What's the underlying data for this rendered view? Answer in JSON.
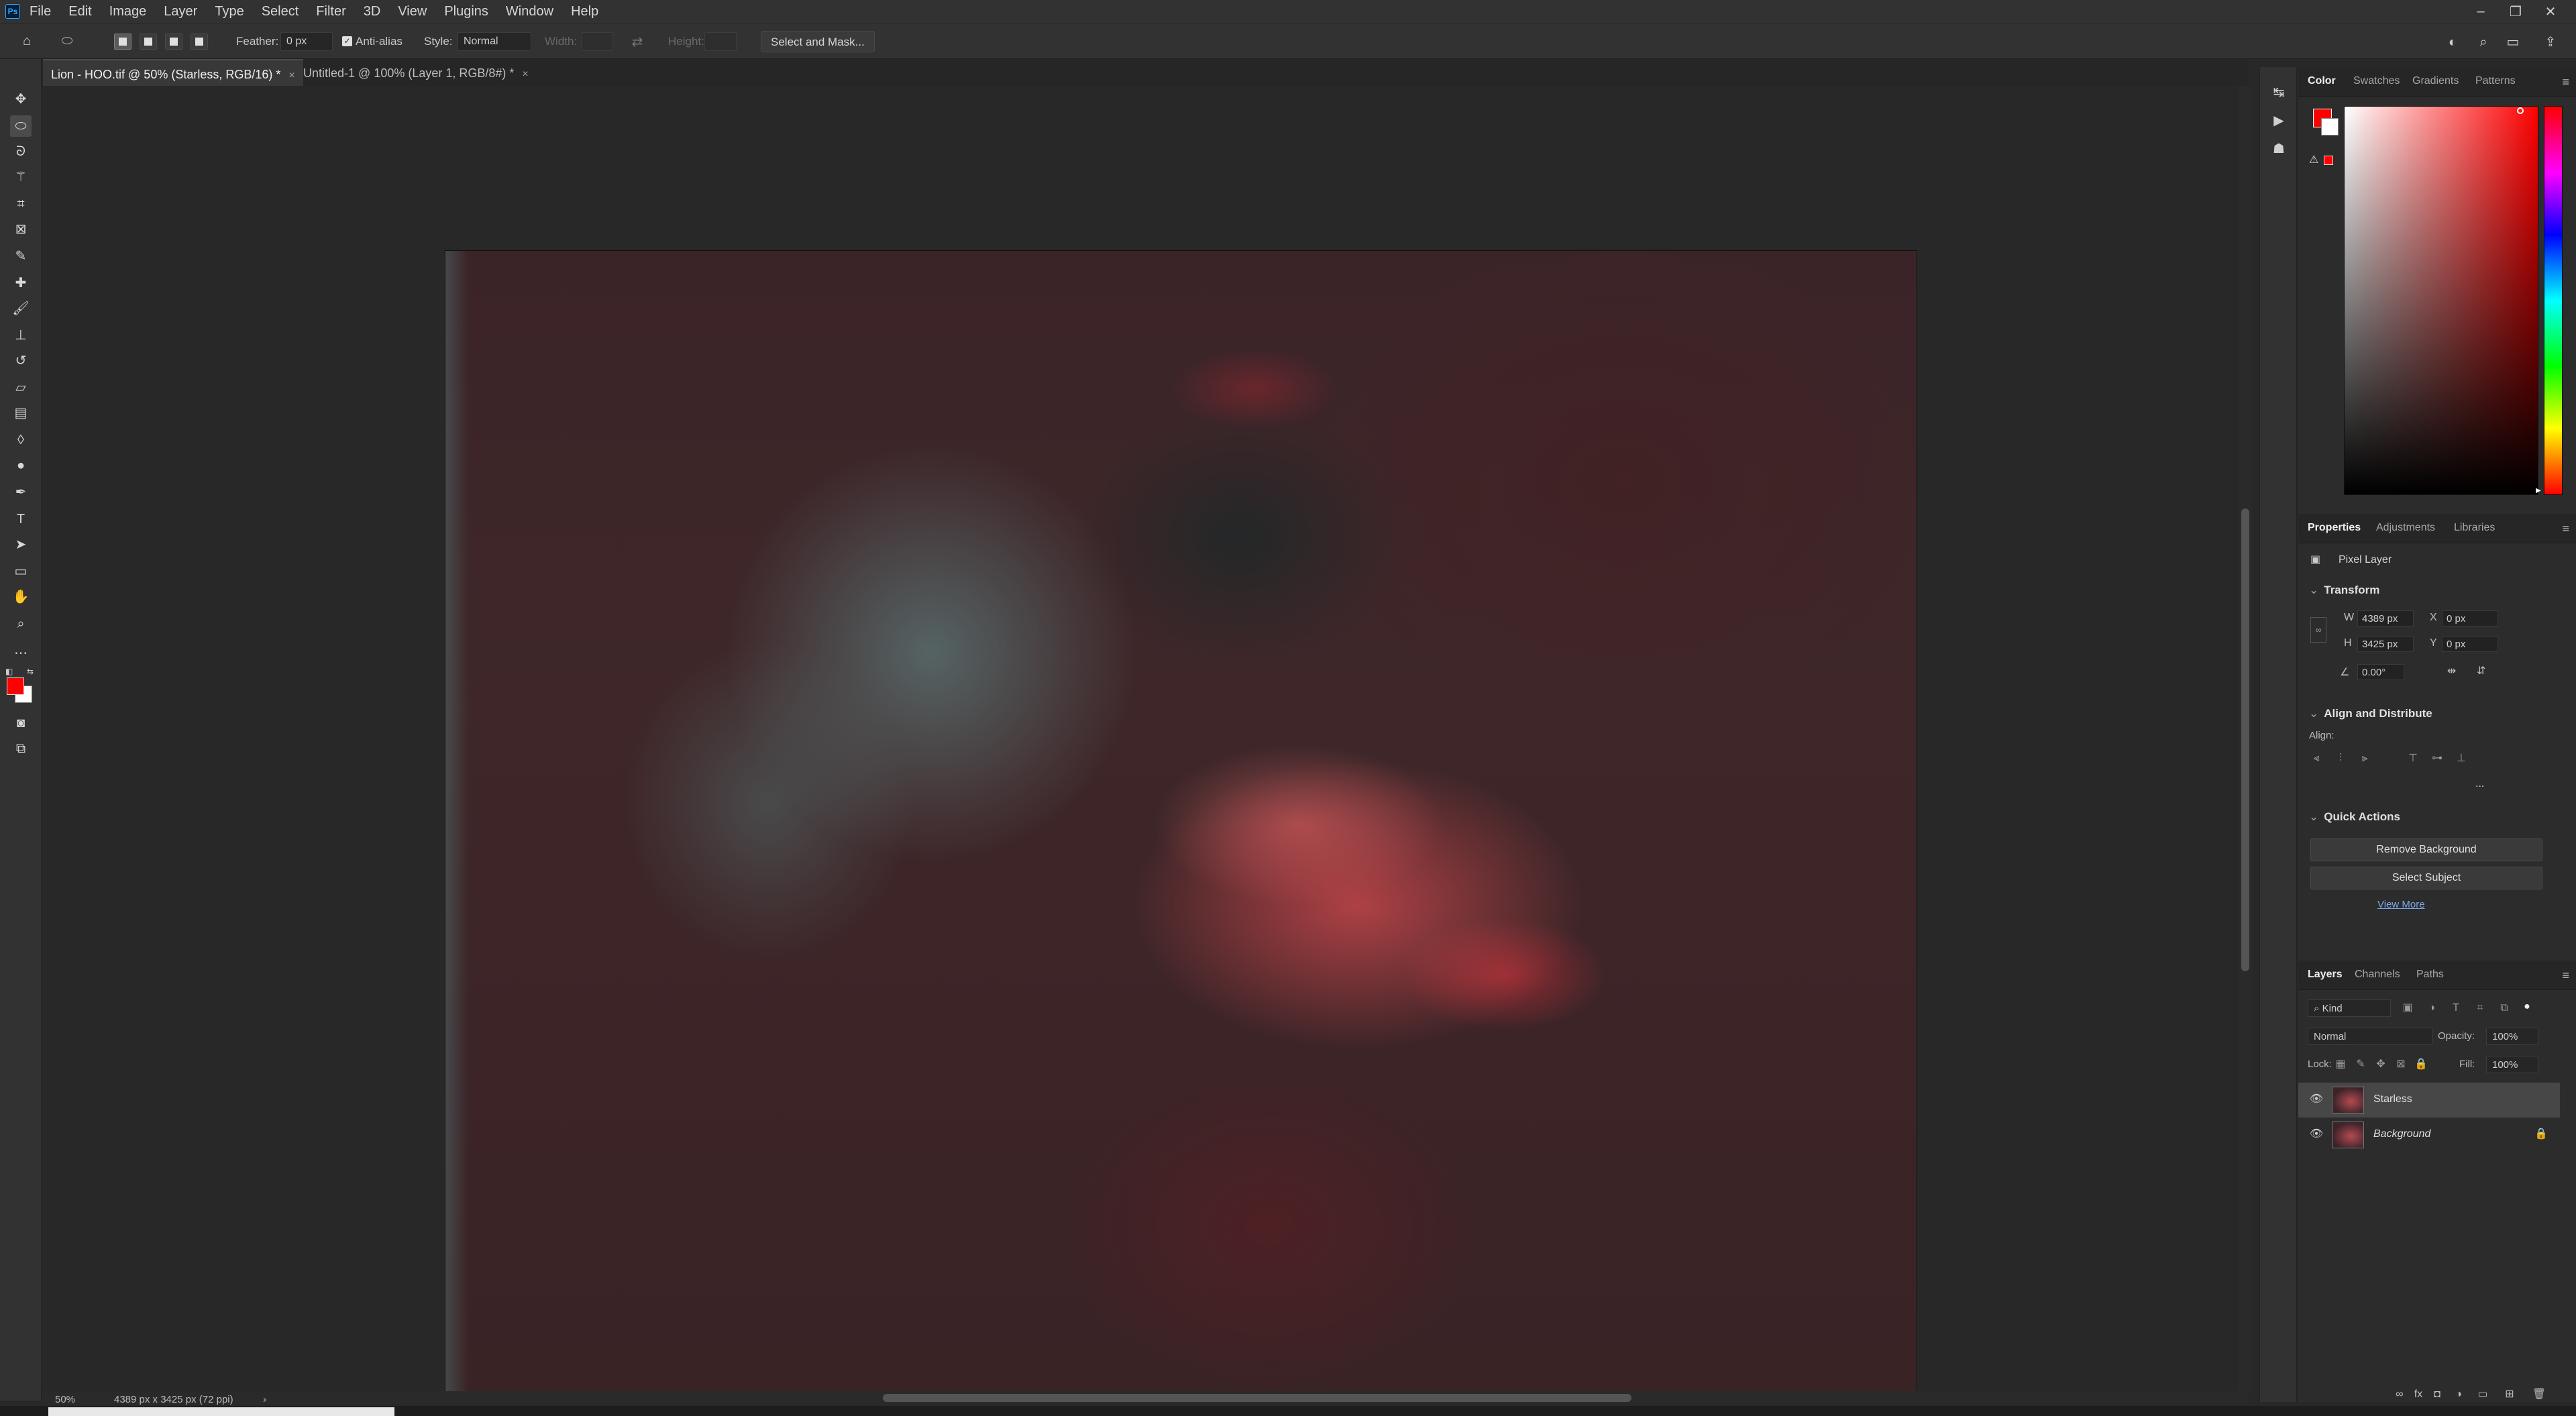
{
  "menu": [
    "File",
    "Edit",
    "Image",
    "Layer",
    "Type",
    "Select",
    "Filter",
    "3D",
    "View",
    "Plugins",
    "Window",
    "Help"
  ],
  "app_icon": "Ps",
  "window_controls": {
    "minimize": "–",
    "restore": "❐",
    "close": "✕"
  },
  "options": {
    "feather_label": "Feather:",
    "feather_value": "0 px",
    "antialias_label": "Anti-alias",
    "style_label": "Style:",
    "style_value": "Normal",
    "width_label": "Width:",
    "height_label": "Height:",
    "select_mask_button": "Select and Mask..."
  },
  "tabs": [
    {
      "label": "Lion - HOO.tif @ 50% (Starless, RGB/16) *",
      "close": "×"
    },
    {
      "label": "Untitled-1 @ 100% (Layer 1, RGB/8#) *",
      "close": "×"
    }
  ],
  "status": {
    "zoom": "50%",
    "doc_size": "4389 px x 3425 px (72 ppi)",
    "arrow": "›"
  },
  "color_panel": {
    "tabs": [
      "Color",
      "Swatches",
      "Gradients",
      "Patterns"
    ],
    "foreground": "#ff0000",
    "background": "#ffffff"
  },
  "properties_panel": {
    "tabs": [
      "Properties",
      "Adjustments",
      "Libraries"
    ],
    "layer_type": "Pixel Layer",
    "transform_title": "Transform",
    "w_label": "W",
    "w_value": "4389 px",
    "h_label": "H",
    "h_value": "3425 px",
    "x_label": "X",
    "x_value": "0 px",
    "y_label": "Y",
    "y_value": "0 px",
    "angle_value": "0.00°",
    "align_title": "Align and Distribute",
    "align_label": "Align:",
    "more": "...",
    "quick_title": "Quick Actions",
    "remove_bg_button": "Remove Background",
    "select_subject_button": "Select Subject",
    "view_more_link": "View More"
  },
  "layers_panel": {
    "tabs": [
      "Layers",
      "Channels",
      "Paths"
    ],
    "kind_filter": "Kind",
    "blend_mode": "Normal",
    "opacity_label": "Opacity:",
    "opacity_value": "100%",
    "lock_label": "Lock:",
    "fill_label": "Fill:",
    "fill_value": "100%",
    "layers": [
      {
        "name": "Starless",
        "selected": true
      },
      {
        "name": "Background",
        "selected": false,
        "locked": true
      }
    ]
  }
}
